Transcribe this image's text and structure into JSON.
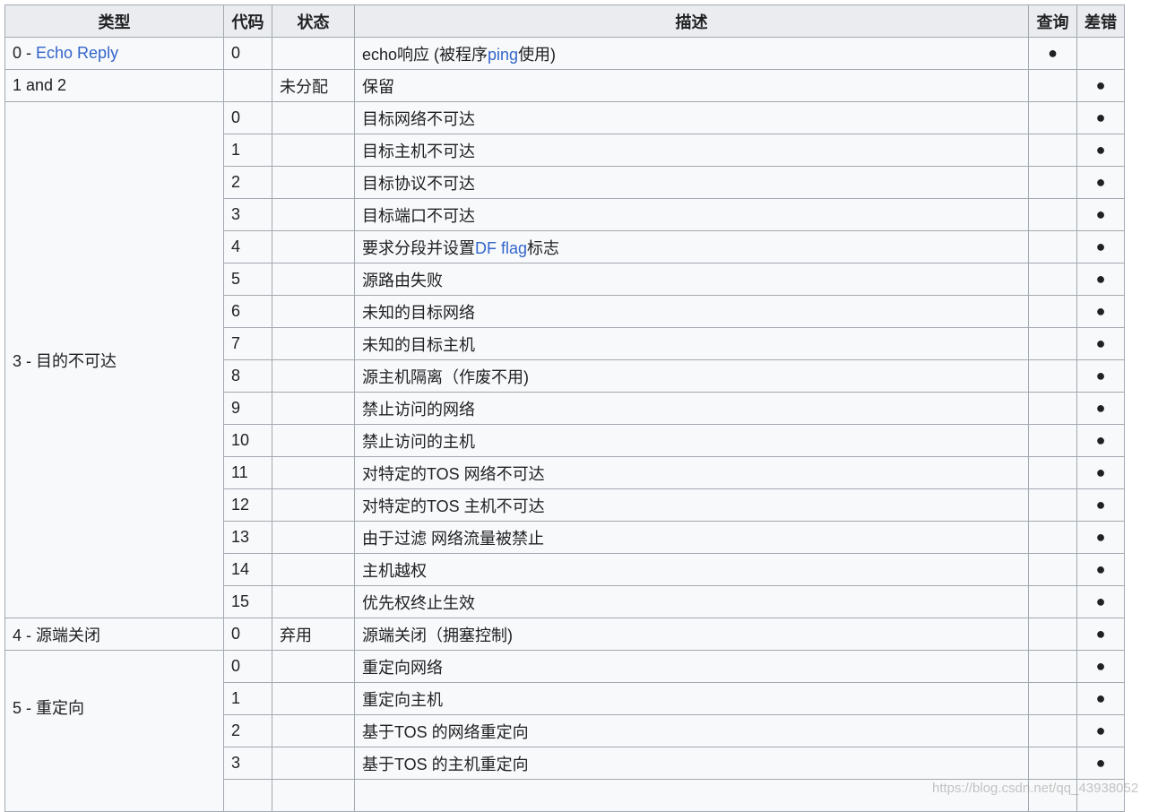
{
  "headers": {
    "type": "类型",
    "code": "代码",
    "status": "状态",
    "desc": "描述",
    "query": "查询",
    "error": "差错"
  },
  "dot": "●",
  "rows": {
    "r0": {
      "type_num": "0 - ",
      "type_link": "Echo Reply",
      "code": "0",
      "desc_a": "echo响应 (被程序",
      "desc_link": "ping",
      "desc_b": "使用)"
    },
    "r1": {
      "type": "1 and 2",
      "status": "未分配",
      "desc": "保留"
    },
    "g3": {
      "type": "3 - 目的不可达"
    },
    "r3_0": {
      "code": "0",
      "desc": "目标网络不可达"
    },
    "r3_1": {
      "code": "1",
      "desc": "目标主机不可达"
    },
    "r3_2": {
      "code": "2",
      "desc": "目标协议不可达"
    },
    "r3_3": {
      "code": "3",
      "desc": "目标端口不可达"
    },
    "r3_4": {
      "code": "4",
      "desc_a": "要求分段并设置",
      "desc_link": "DF flag",
      "desc_b": "标志"
    },
    "r3_5": {
      "code": "5",
      "desc": "源路由失败"
    },
    "r3_6": {
      "code": "6",
      "desc": "未知的目标网络"
    },
    "r3_7": {
      "code": "7",
      "desc": "未知的目标主机"
    },
    "r3_8": {
      "code": "8",
      "desc": "源主机隔离（作废不用)"
    },
    "r3_9": {
      "code": "9",
      "desc": "禁止访问的网络"
    },
    "r3_10": {
      "code": "10",
      "desc": "禁止访问的主机"
    },
    "r3_11": {
      "code": "11",
      "desc": "对特定的TOS 网络不可达"
    },
    "r3_12": {
      "code": "12",
      "desc": "对特定的TOS 主机不可达"
    },
    "r3_13": {
      "code": "13",
      "desc": "由于过滤 网络流量被禁止"
    },
    "r3_14": {
      "code": "14",
      "desc": "主机越权"
    },
    "r3_15": {
      "code": "15",
      "desc": "优先权终止生效"
    },
    "r4": {
      "type": "4 - 源端关闭",
      "code": "0",
      "status": "弃用",
      "desc": "源端关闭（拥塞控制)"
    },
    "g5": {
      "type": "5 - 重定向"
    },
    "r5_0": {
      "code": "0",
      "desc": "重定向网络"
    },
    "r5_1": {
      "code": "1",
      "desc": "重定向主机"
    },
    "r5_2": {
      "code": "2",
      "desc": "基于TOS 的网络重定向"
    },
    "r5_3": {
      "code": "3",
      "desc": "基于TOS 的主机重定向"
    }
  },
  "watermark": "https://blog.csdn.net/qq_43938052"
}
